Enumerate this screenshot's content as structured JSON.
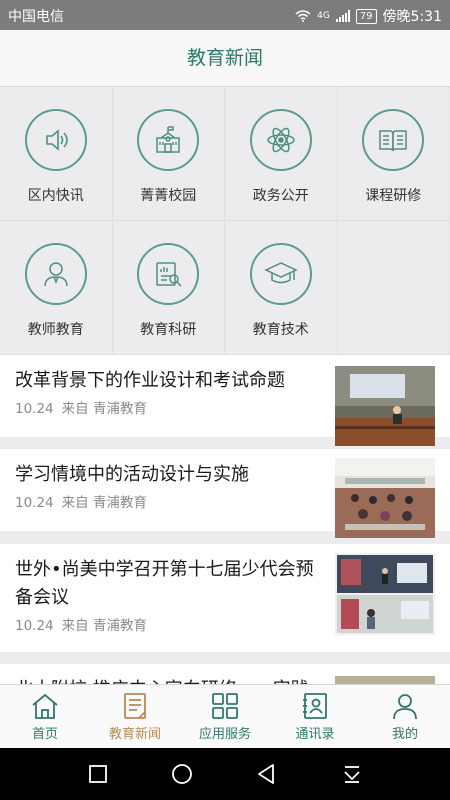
{
  "status": {
    "carrier": "中国电信",
    "battery": "79",
    "time": "傍晚5:31",
    "network": "4G"
  },
  "header": {
    "title": "教育新闻"
  },
  "grid": [
    {
      "label": "区内快讯",
      "icon": "speaker-icon"
    },
    {
      "label": "菁菁校园",
      "icon": "school-icon"
    },
    {
      "label": "政务公开",
      "icon": "atom-icon"
    },
    {
      "label": "课程研修",
      "icon": "book-icon"
    },
    {
      "label": "教师教育",
      "icon": "teacher-icon"
    },
    {
      "label": "教育科研",
      "icon": "research-icon"
    },
    {
      "label": "教育技术",
      "icon": "graduation-cap-icon"
    }
  ],
  "news": [
    {
      "title": "改革背景下的作业设计和考试命题",
      "date": "10.24",
      "source": "来自 青浦教育"
    },
    {
      "title": "学习情境中的活动设计与实施",
      "date": "10.24",
      "source": "来自 青浦教育"
    },
    {
      "title": "世外•尚美中学召开第十七届少代会预备会议",
      "date": "10.24",
      "source": "来自 青浦教育"
    },
    {
      "title": "北大附校 推广中心定向研修——实践",
      "date": "",
      "source": ""
    }
  ],
  "tabs": [
    {
      "label": "首页",
      "icon": "home-icon"
    },
    {
      "label": "教育新闻",
      "icon": "news-icon",
      "active": true
    },
    {
      "label": "应用服务",
      "icon": "apps-icon"
    },
    {
      "label": "通讯录",
      "icon": "contacts-icon"
    },
    {
      "label": "我的",
      "icon": "profile-icon"
    }
  ],
  "colors": {
    "accent": "#2d7a6c",
    "icon_stroke": "#5b9c8c",
    "active_tab": "#b98a52"
  }
}
